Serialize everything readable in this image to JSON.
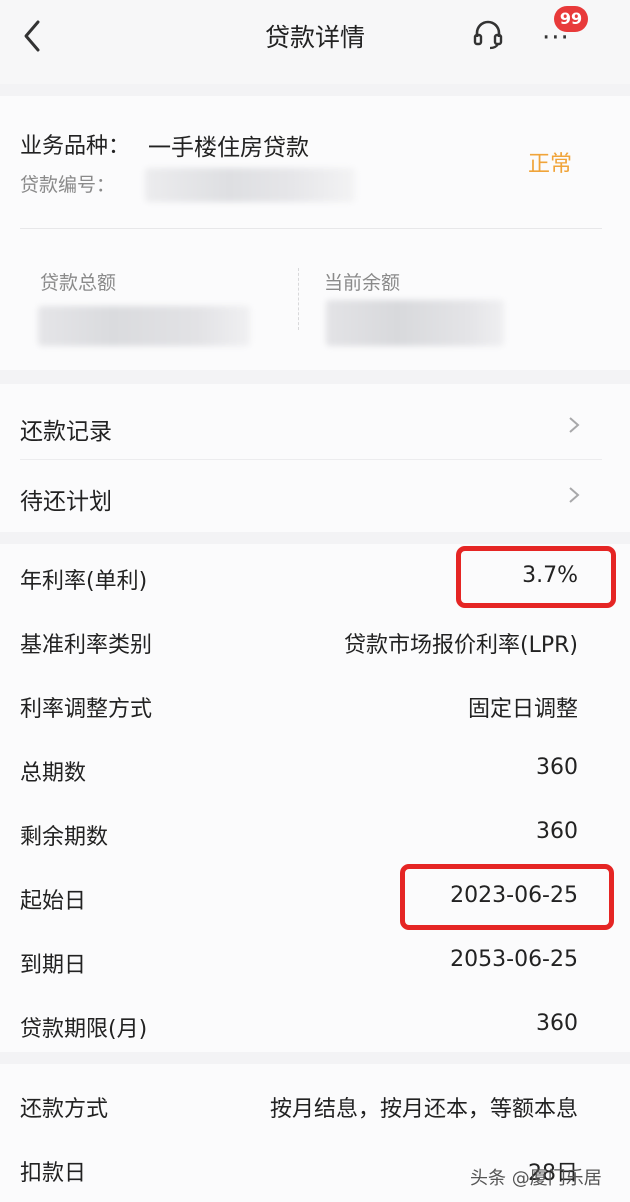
{
  "nav": {
    "title": "贷款详情",
    "badge": "99",
    "back_icon": "chevron-left-icon",
    "service_icon": "headset-icon",
    "more_icon": "more-dots-icon"
  },
  "summary": {
    "business_type_label": "业务品种：",
    "business_type_value": "一手楼住房贷款",
    "status": "正常",
    "loan_no_label": "贷款编号：",
    "total_label": "贷款总额",
    "remaining_label": "当前余额"
  },
  "links": [
    {
      "label": "还款记录"
    },
    {
      "label": "待还计划"
    }
  ],
  "info": [
    {
      "label": "年利率(单利)",
      "value": "3.7%"
    },
    {
      "label": "基准利率类别",
      "value": "贷款市场报价利率(LPR)"
    },
    {
      "label": "利率调整方式",
      "value": "固定日调整"
    },
    {
      "label": "总期数",
      "value": "360"
    },
    {
      "label": "剩余期数",
      "value": "360"
    },
    {
      "label": "起始日",
      "value": "2023-06-25"
    },
    {
      "label": "到期日",
      "value": "2053-06-25"
    },
    {
      "label": "贷款期限(月)",
      "value": "360"
    }
  ],
  "payment": [
    {
      "label": "还款方式",
      "value": "按月结息，按月还本，等额本息"
    },
    {
      "label": "扣款日",
      "value": "28日"
    }
  ],
  "watermark": "头条 @厦门乐居",
  "colors": {
    "status": "#f0a43a",
    "highlight": "#e52524",
    "badge": "#e83a3a"
  }
}
